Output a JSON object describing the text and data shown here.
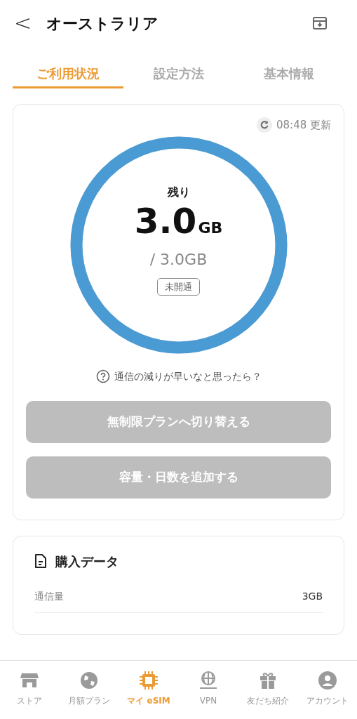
{
  "header": {
    "back": "<",
    "title": "オーストラリア"
  },
  "tabs": [
    {
      "label": "ご利用状況",
      "selected": true
    },
    {
      "label": "設定方法",
      "selected": false
    },
    {
      "label": "基本情報",
      "selected": false
    }
  ],
  "usage": {
    "updated": "08:48 更新",
    "remaining_label": "残り",
    "amount": "3.0",
    "unit": "GB",
    "total": "/ 3.0GB",
    "status": "未開通",
    "level": 1,
    "help": "通信の減りが早いなと思ったら？",
    "buttons": [
      {
        "label": "無制限プランへ切り替える",
        "disabled": true
      },
      {
        "label": "容量・日数を追加する",
        "disabled": true
      }
    ]
  },
  "purchase": {
    "title": "購入データ",
    "rows": [
      {
        "label": "通信量",
        "value": "3GB"
      }
    ]
  },
  "nav": [
    {
      "label": "ストア",
      "kind": "store",
      "selected": false
    },
    {
      "label": "月額プラン",
      "kind": "globe",
      "selected": false
    },
    {
      "label": "マイ eSIM",
      "kind": "chip",
      "selected": true
    },
    {
      "label": "VPN",
      "kind": "network",
      "selected": false
    },
    {
      "label": "友だち紹介",
      "kind": "gift",
      "selected": false
    },
    {
      "label": "アカウント",
      "kind": "user",
      "selected": false
    }
  ]
}
